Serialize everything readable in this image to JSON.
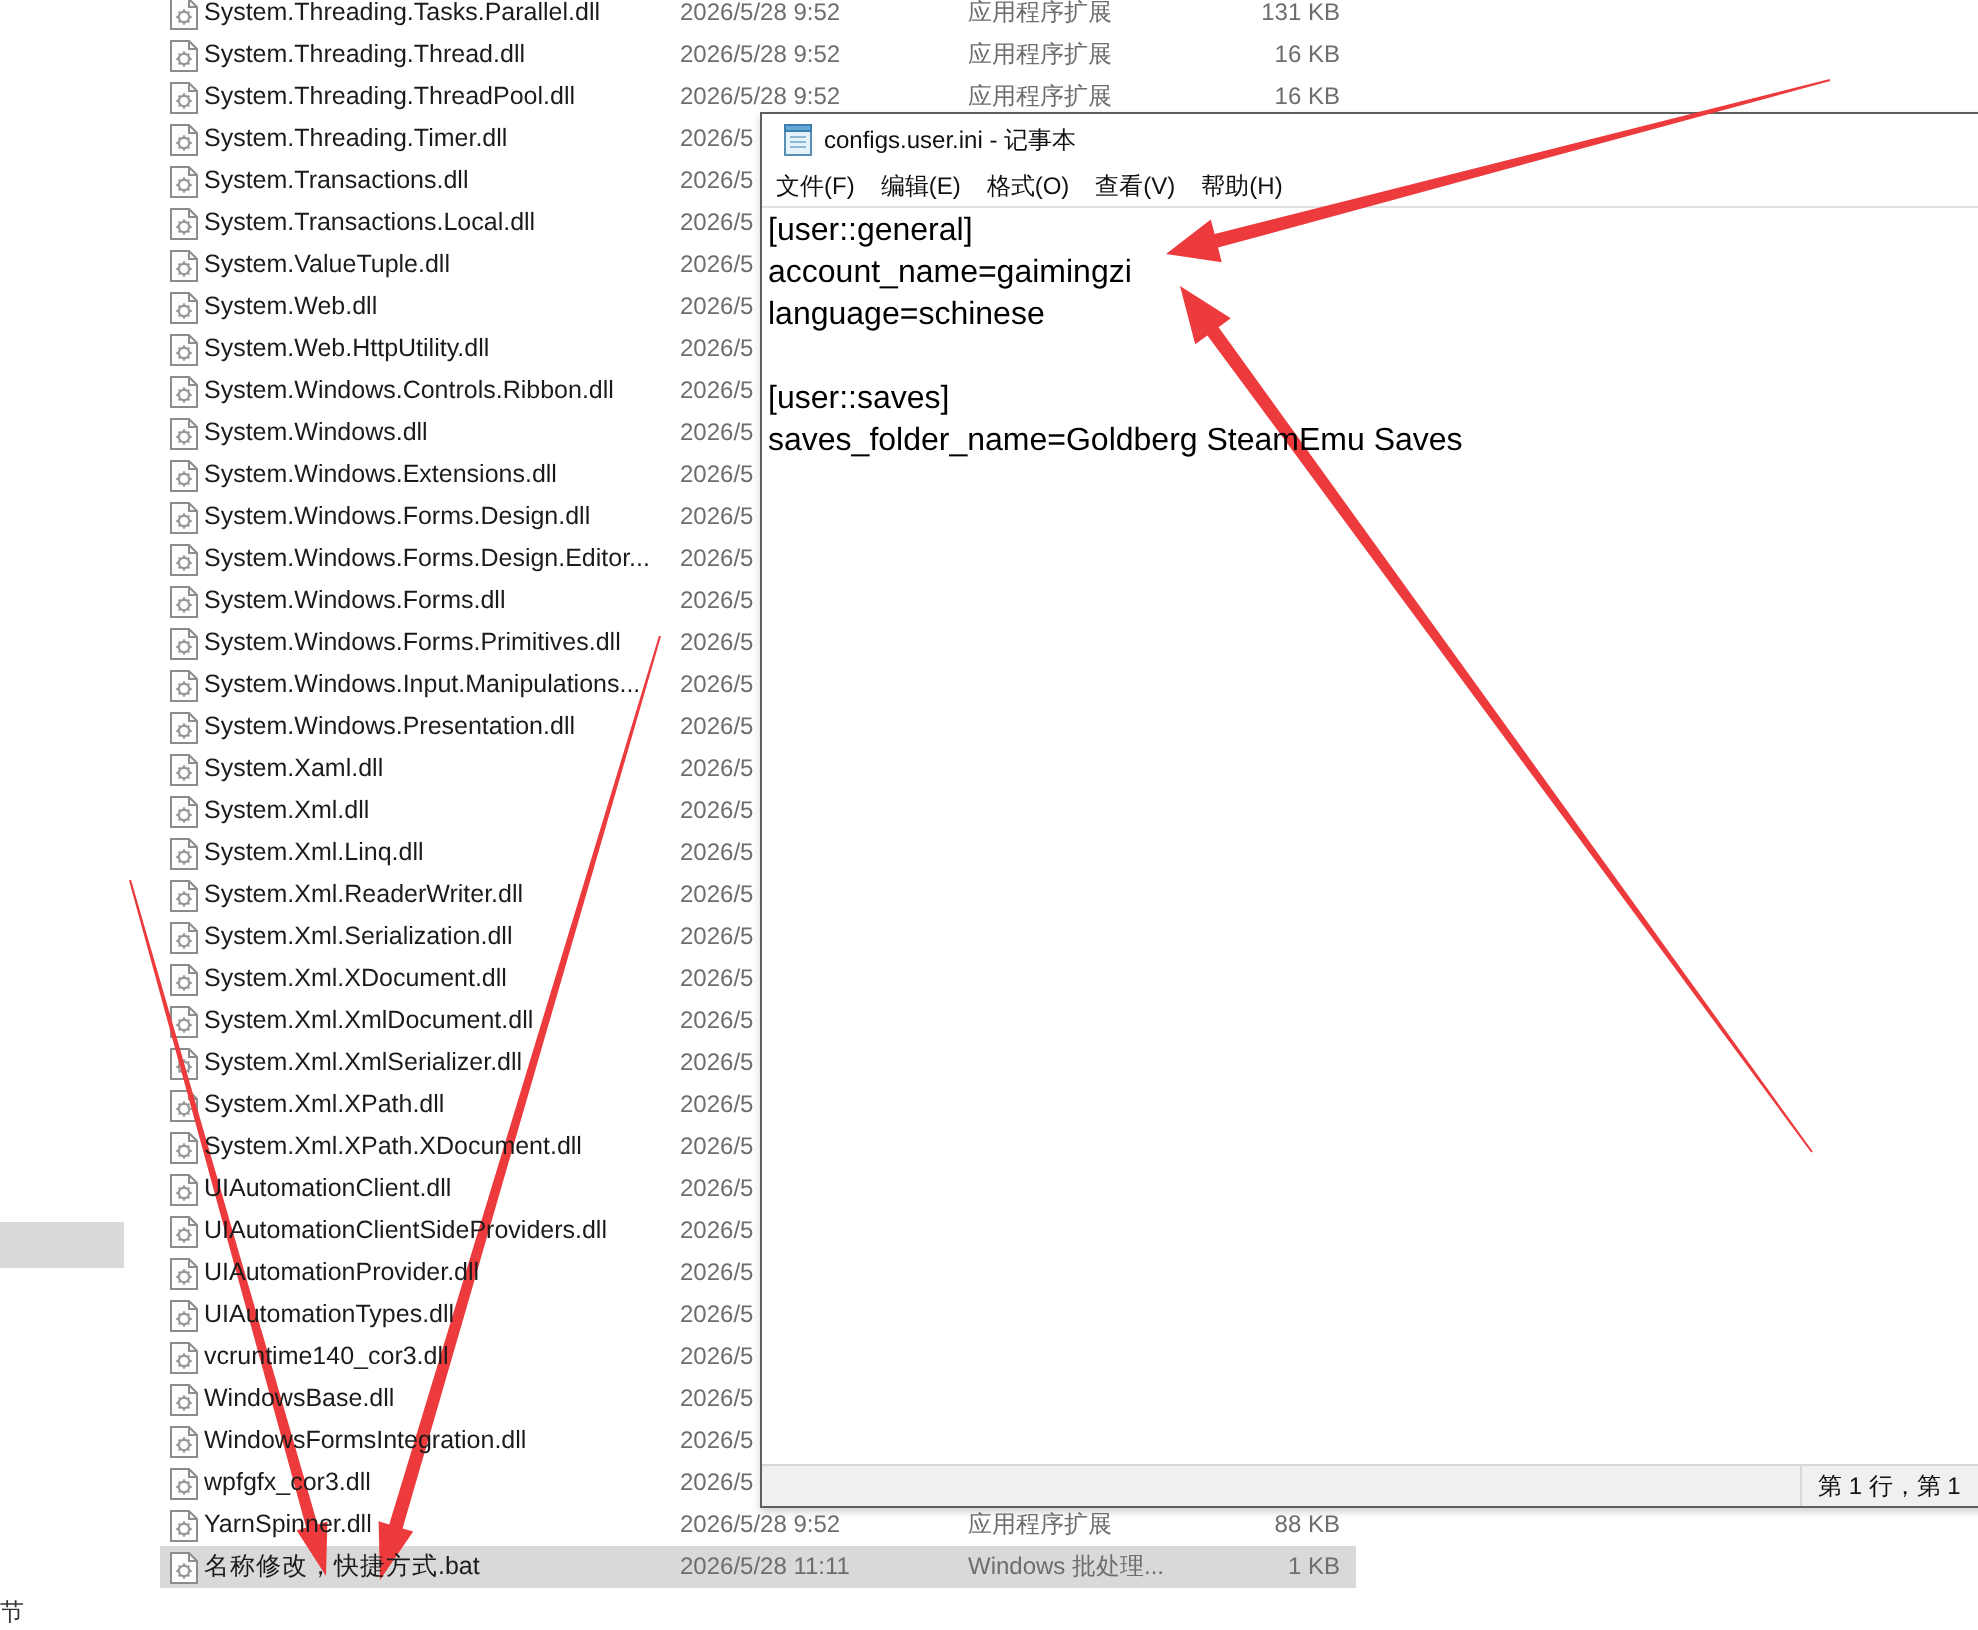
{
  "explorer": {
    "nav_pane": {
      "items": [
        {
          "selected": true
        }
      ]
    },
    "files": [
      {
        "name": "System.Threading.Tasks.Parallel.dll",
        "date": "2026/5/28 9:52",
        "type": "应用程序扩展",
        "size": "131 KB",
        "selected": false
      },
      {
        "name": "System.Threading.Thread.dll",
        "date": "2026/5/28 9:52",
        "type": "应用程序扩展",
        "size": "16 KB",
        "selected": false
      },
      {
        "name": "System.Threading.ThreadPool.dll",
        "date": "2026/5/28 9:52",
        "type": "应用程序扩展",
        "size": "16 KB",
        "selected": false
      },
      {
        "name": "System.Threading.Timer.dll",
        "date": "2026/5",
        "selected": false
      },
      {
        "name": "System.Transactions.dll",
        "date": "2026/5",
        "selected": false
      },
      {
        "name": "System.Transactions.Local.dll",
        "date": "2026/5",
        "selected": false
      },
      {
        "name": "System.ValueTuple.dll",
        "date": "2026/5",
        "selected": false
      },
      {
        "name": "System.Web.dll",
        "date": "2026/5",
        "selected": false
      },
      {
        "name": "System.Web.HttpUtility.dll",
        "date": "2026/5",
        "selected": false
      },
      {
        "name": "System.Windows.Controls.Ribbon.dll",
        "date": "2026/5",
        "selected": false
      },
      {
        "name": "System.Windows.dll",
        "date": "2026/5",
        "selected": false
      },
      {
        "name": "System.Windows.Extensions.dll",
        "date": "2026/5",
        "selected": false
      },
      {
        "name": "System.Windows.Forms.Design.dll",
        "date": "2026/5",
        "selected": false
      },
      {
        "name": "System.Windows.Forms.Design.Editor...",
        "date": "2026/5",
        "selected": false
      },
      {
        "name": "System.Windows.Forms.dll",
        "date": "2026/5",
        "selected": false
      },
      {
        "name": "System.Windows.Forms.Primitives.dll",
        "date": "2026/5",
        "selected": false
      },
      {
        "name": "System.Windows.Input.Manipulations...",
        "date": "2026/5",
        "selected": false
      },
      {
        "name": "System.Windows.Presentation.dll",
        "date": "2026/5",
        "selected": false
      },
      {
        "name": "System.Xaml.dll",
        "date": "2026/5",
        "selected": false
      },
      {
        "name": "System.Xml.dll",
        "date": "2026/5",
        "selected": false
      },
      {
        "name": "System.Xml.Linq.dll",
        "date": "2026/5",
        "selected": false
      },
      {
        "name": "System.Xml.ReaderWriter.dll",
        "date": "2026/5",
        "selected": false
      },
      {
        "name": "System.Xml.Serialization.dll",
        "date": "2026/5",
        "selected": false
      },
      {
        "name": "System.Xml.XDocument.dll",
        "date": "2026/5",
        "selected": false
      },
      {
        "name": "System.Xml.XmlDocument.dll",
        "date": "2026/5",
        "selected": false
      },
      {
        "name": "System.Xml.XmlSerializer.dll",
        "date": "2026/5",
        "selected": false
      },
      {
        "name": "System.Xml.XPath.dll",
        "date": "2026/5",
        "selected": false
      },
      {
        "name": "System.Xml.XPath.XDocument.dll",
        "date": "2026/5",
        "selected": false
      },
      {
        "name": "UIAutomationClient.dll",
        "date": "2026/5",
        "selected": false
      },
      {
        "name": "UIAutomationClientSideProviders.dll",
        "date": "2026/5",
        "selected": false
      },
      {
        "name": "UIAutomationProvider.dll",
        "date": "2026/5",
        "selected": false
      },
      {
        "name": "UIAutomationTypes.dll",
        "date": "2026/5",
        "selected": false
      },
      {
        "name": "vcruntime140_cor3.dll",
        "date": "2026/5",
        "selected": false
      },
      {
        "name": "WindowsBase.dll",
        "date": "2026/5",
        "selected": false
      },
      {
        "name": "WindowsFormsIntegration.dll",
        "date": "2026/5",
        "selected": false
      },
      {
        "name": "wpfgfx_cor3.dll",
        "date": "2026/5",
        "selected": false
      },
      {
        "name": "YarnSpinner.dll",
        "date": "2026/5/28 9:52",
        "type": "应用程序扩展",
        "size": "88 KB",
        "selected": false
      },
      {
        "name": "名称修改，快捷方式.bat",
        "date": "2026/5/28 11:11",
        "type": "Windows 批处理...",
        "size": "1 KB",
        "selected": true
      }
    ],
    "status_text": "节"
  },
  "notepad": {
    "title": "configs.user.ini - 记事本",
    "menu": [
      "文件(F)",
      "编辑(E)",
      "格式(O)",
      "查看(V)",
      "帮助(H)"
    ],
    "sections": [
      {
        "lines": [
          "[user::general]",
          "account_name=gaimingzi",
          "language=schinese"
        ]
      },
      {
        "lines": [
          "[user::saves]",
          "saves_folder_name=Goldberg SteamEmu Saves"
        ]
      }
    ],
    "status": "第 1 行，第 1"
  }
}
